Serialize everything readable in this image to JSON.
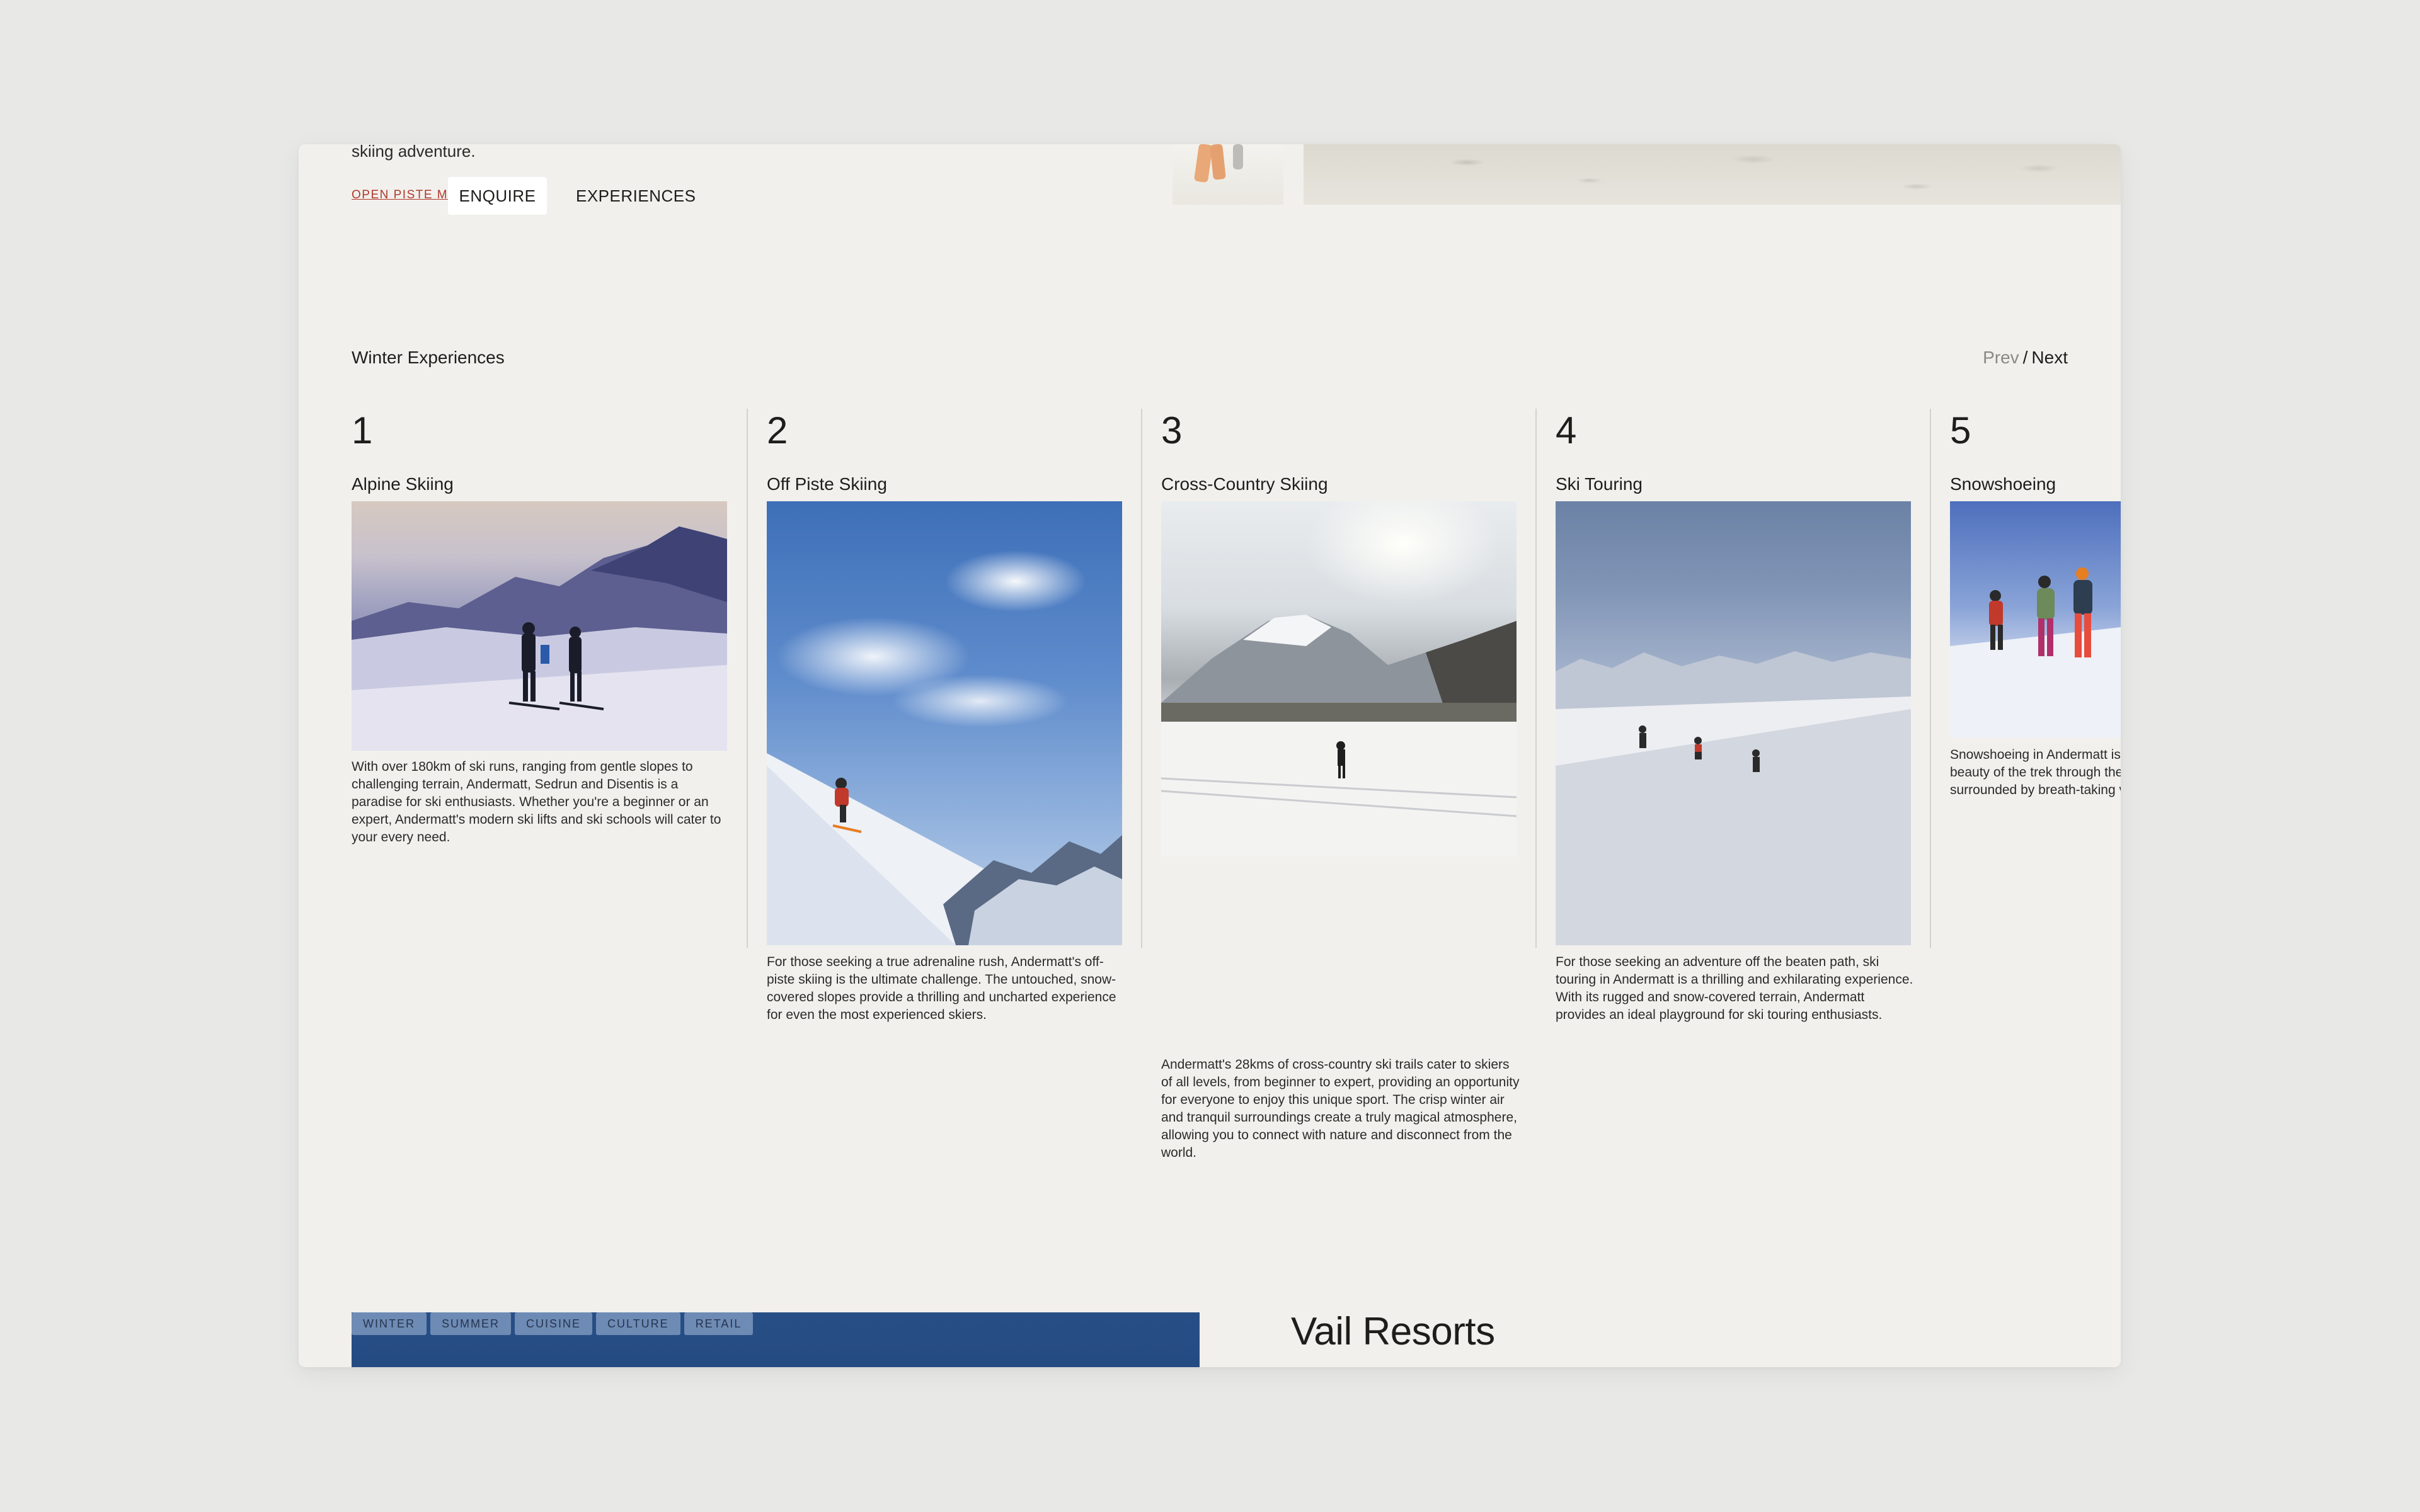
{
  "hero": {
    "intro_text": "skiing adventure.",
    "open_piste_label": "OPEN PISTE MAP",
    "enquire_label": "ENQUIRE",
    "experiences_label": "EXPERIENCES"
  },
  "section": {
    "title": "Winter Experiences",
    "pager": {
      "prev": "Prev",
      "separator": "/",
      "next": "Next"
    }
  },
  "experiences": [
    {
      "number": "1",
      "name": "Alpine Skiing",
      "description": "With over 180km of ski runs, ranging from gentle slopes to challenging terrain, Andermatt, Sedrun and Disentis is a paradise for ski enthusiasts. Whether you're a beginner or an expert, Andermatt's modern ski lifts and ski schools will cater to your every need."
    },
    {
      "number": "2",
      "name": "Off Piste Skiing",
      "description": "For those seeking a true adrenaline rush, Andermatt's off-piste skiing is the ultimate challenge. The untouched, snow-covered slopes provide a thrilling and uncharted experience for even the most experienced skiers."
    },
    {
      "number": "3",
      "name": "Cross-Country Skiing",
      "description": "Andermatt's 28kms of cross-country ski trails cater to skiers of all levels, from beginner to expert, providing an opportunity for everyone to enjoy this unique sport. The crisp winter air and tranquil surroundings create a truly magical atmosphere, allowing you to connect with nature and disconnect from the world."
    },
    {
      "number": "4",
      "name": "Ski Touring",
      "description": "For those seeking an adventure off the beaten path, ski touring in Andermatt is a thrilling and exhilarating experience. With its rugged and snow-covered terrain, Andermatt provides an ideal playground for ski touring enthusiasts."
    },
    {
      "number": "5",
      "name": "Snowshoeing",
      "description": "Snowshoeing in Andermatt is a wonderful way to experience the beauty of the trek through the snow-covered landscape, surrounded by breath-taking valleys."
    }
  ],
  "resort": {
    "tags": [
      "WINTER",
      "SUMMER",
      "CUISINE",
      "CULTURE",
      "RETAIL"
    ],
    "title": "Vail Resorts"
  }
}
